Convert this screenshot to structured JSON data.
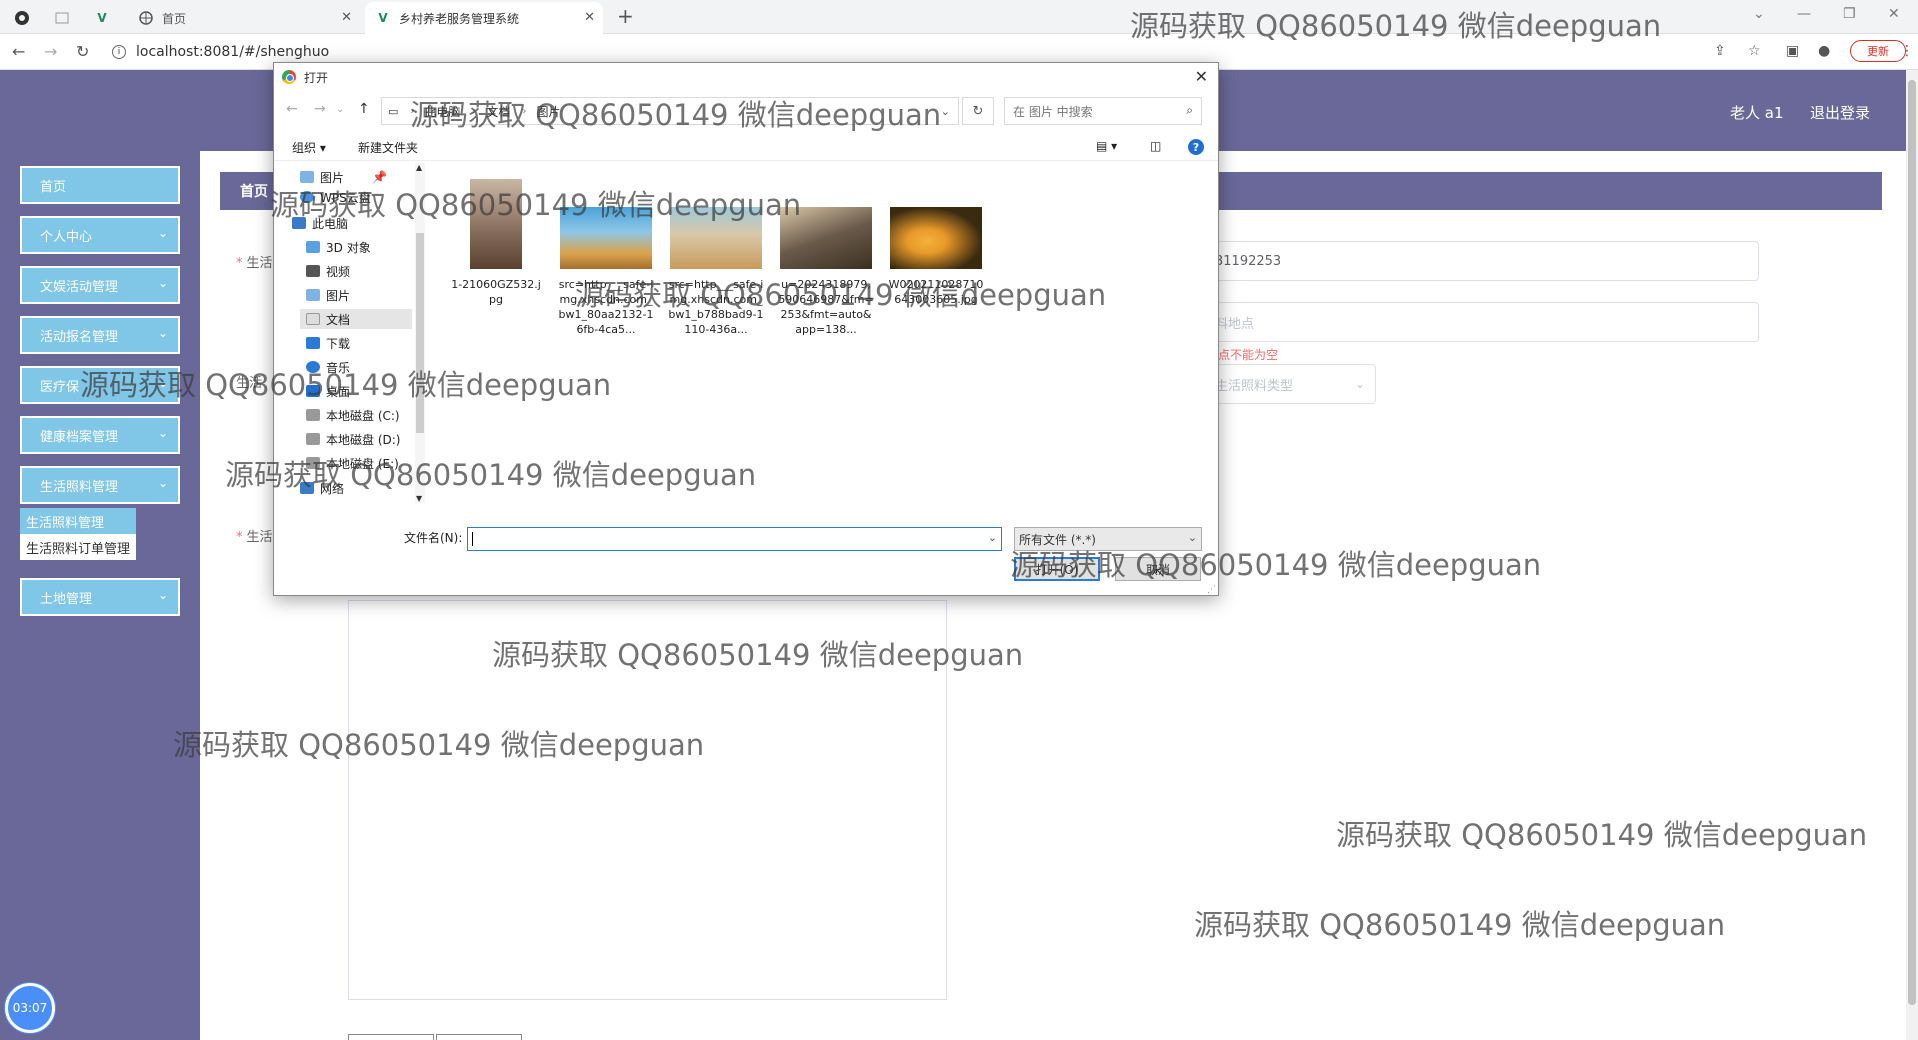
{
  "browser": {
    "tabs": [
      {
        "title": "",
        "pinned": true
      },
      {
        "title": "",
        "pinned": true
      },
      {
        "title": "",
        "pinned": true
      },
      {
        "title": "首页"
      },
      {
        "title": "乡村养老服务管理系统",
        "active": true
      }
    ],
    "url": "localhost:8081/#/shenghuo",
    "update_label": "更新"
  },
  "header": {
    "user": "老人 a1",
    "logout": "退出登录"
  },
  "sidebar": {
    "items": [
      {
        "label": "首页",
        "has_arrow": false
      },
      {
        "label": "个人中心",
        "has_arrow": true
      },
      {
        "label": "文娱活动管理",
        "has_arrow": true
      },
      {
        "label": "活动报名管理",
        "has_arrow": true
      },
      {
        "label": "医疗保",
        "has_arrow": true
      },
      {
        "label": "健康档案管理",
        "has_arrow": true
      },
      {
        "label": "生活照料管理",
        "has_arrow": true
      },
      {
        "label": "土地管理",
        "has_arrow": true
      }
    ],
    "submenu": [
      "生活照料管理",
      "生活照料订单管理"
    ]
  },
  "breadcrumb": "首页",
  "form": {
    "label_top": "生活",
    "label_mid": "生活",
    "label_bottom": "生活",
    "phone_value": "31192253",
    "location_placeholder": "料地点",
    "location_error": "点不能为空",
    "type_placeholder": "生活照料类型"
  },
  "timer": "03:07",
  "dialog": {
    "title": "打开",
    "path": [
      "此电脑",
      "文档",
      "图片"
    ],
    "search_placeholder": "在 图片 中搜索",
    "organize": "组织 ▾",
    "new_folder": "新建文件夹",
    "tree": [
      "图片",
      "WPS云盘",
      "此电脑",
      "3D 对象",
      "视频",
      "图片",
      "文档",
      "下载",
      "音乐",
      "桌面",
      "本地磁盘 (C:)",
      "本地磁盘 (D:)",
      "本地磁盘 (E:)",
      "网络"
    ],
    "files": [
      {
        "name": "1-21060GZ532.jpg",
        "color1": "#8a7060",
        "color2": "#c9b7a5"
      },
      {
        "name": "src=http___safe-img.xhscdn.com_bw1_80aa2132-16fb-4ca5...",
        "color1": "#4aa3d8",
        "color2": "#d9a24b"
      },
      {
        "name": "src=http___safe-img.xhscdn.com_bw1_b788bad9-1110-436a...",
        "color1": "#9fc9d9",
        "color2": "#c89a5b"
      },
      {
        "name": "u=2024318979,590646987&fm=253&fmt=auto&app=138...",
        "color1": "#6a5a4a",
        "color2": "#d9c8a8"
      },
      {
        "name": "W020211028710643003605.jpg",
        "color1": "#3a2a10",
        "color2": "#e89a2a"
      }
    ],
    "filename_label": "文件名(N):",
    "filetype": "所有文件 (*.*)",
    "open_button": "打开(O)",
    "cancel_button": "取消"
  },
  "watermark_text": "源码获取 QQ86050149 微信deepguan"
}
